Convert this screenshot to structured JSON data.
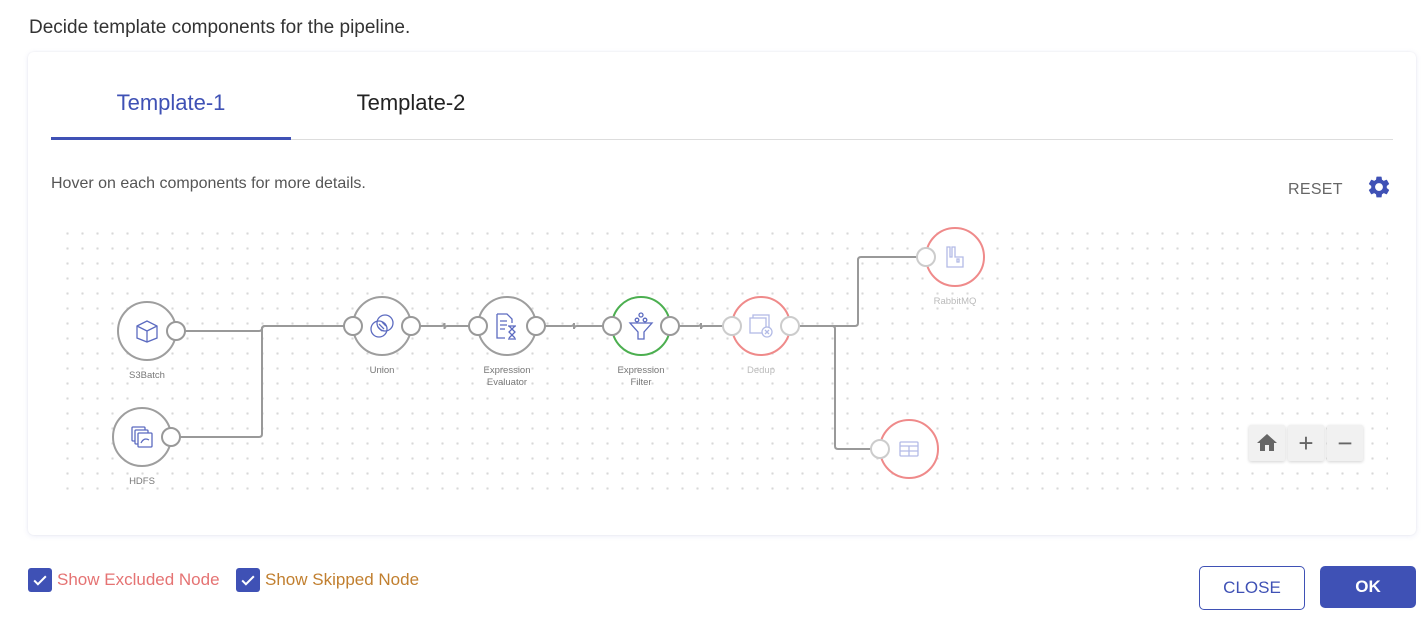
{
  "dialog": {
    "heading": "Decide template components for the pipeline.",
    "tabs": [
      {
        "label": "Template-1",
        "active": true
      },
      {
        "label": "Template-2",
        "active": false
      }
    ],
    "hint": "Hover on each components for more details.",
    "reset_label": "RESET",
    "settings_icon": "gear-icon",
    "colors": {
      "accent": "#3f51b5",
      "included_node": "#9e9e9e",
      "selected_node": "#4caf50",
      "excluded_node": "#ef8a8a",
      "excluded_text": "#e57373",
      "skipped_text": "#c17f2f"
    }
  },
  "pipeline": {
    "nodes": [
      {
        "id": "s3batch",
        "label": [
          "S3Batch"
        ],
        "icon": "cube-icon",
        "state": "included"
      },
      {
        "id": "hdfs",
        "label": [
          "HDFS"
        ],
        "icon": "hdfs-stack-icon",
        "state": "included"
      },
      {
        "id": "union",
        "label": [
          "Union"
        ],
        "icon": "union-circles-icon",
        "state": "included"
      },
      {
        "id": "expr-eval",
        "label": [
          "Expression",
          "Evaluator"
        ],
        "icon": "document-hourglass-icon",
        "state": "included"
      },
      {
        "id": "expr-filter",
        "label": [
          "Expression",
          "Filter"
        ],
        "icon": "funnel-icon",
        "state": "selected"
      },
      {
        "id": "dedup",
        "label": [
          "Dedup"
        ],
        "icon": "dedup-windows-icon",
        "state": "excluded"
      },
      {
        "id": "rabbitmq",
        "label": [
          "RabbitMQ"
        ],
        "icon": "rabbitmq-icon",
        "state": "excluded"
      },
      {
        "id": "table-sink",
        "label": [
          ""
        ],
        "icon": "table-icon",
        "state": "excluded"
      }
    ],
    "edges": [
      [
        "s3batch",
        "union"
      ],
      [
        "hdfs",
        "union"
      ],
      [
        "union",
        "expr-eval"
      ],
      [
        "expr-eval",
        "expr-filter"
      ],
      [
        "expr-filter",
        "dedup"
      ],
      [
        "dedup",
        "rabbitmq"
      ],
      [
        "dedup",
        "table-sink"
      ]
    ]
  },
  "zoom_controls": [
    {
      "name": "home",
      "icon": "home-icon",
      "glyph": ""
    },
    {
      "name": "zoom-in",
      "icon": "plus-icon",
      "glyph": "+"
    },
    {
      "name": "zoom-out",
      "icon": "minus-icon",
      "glyph": "−"
    }
  ],
  "footer": {
    "show_excluded": {
      "label": "Show Excluded Node",
      "checked": true
    },
    "show_skipped": {
      "label": "Show Skipped Node",
      "checked": true
    },
    "close_label": "CLOSE",
    "ok_label": "OK"
  }
}
